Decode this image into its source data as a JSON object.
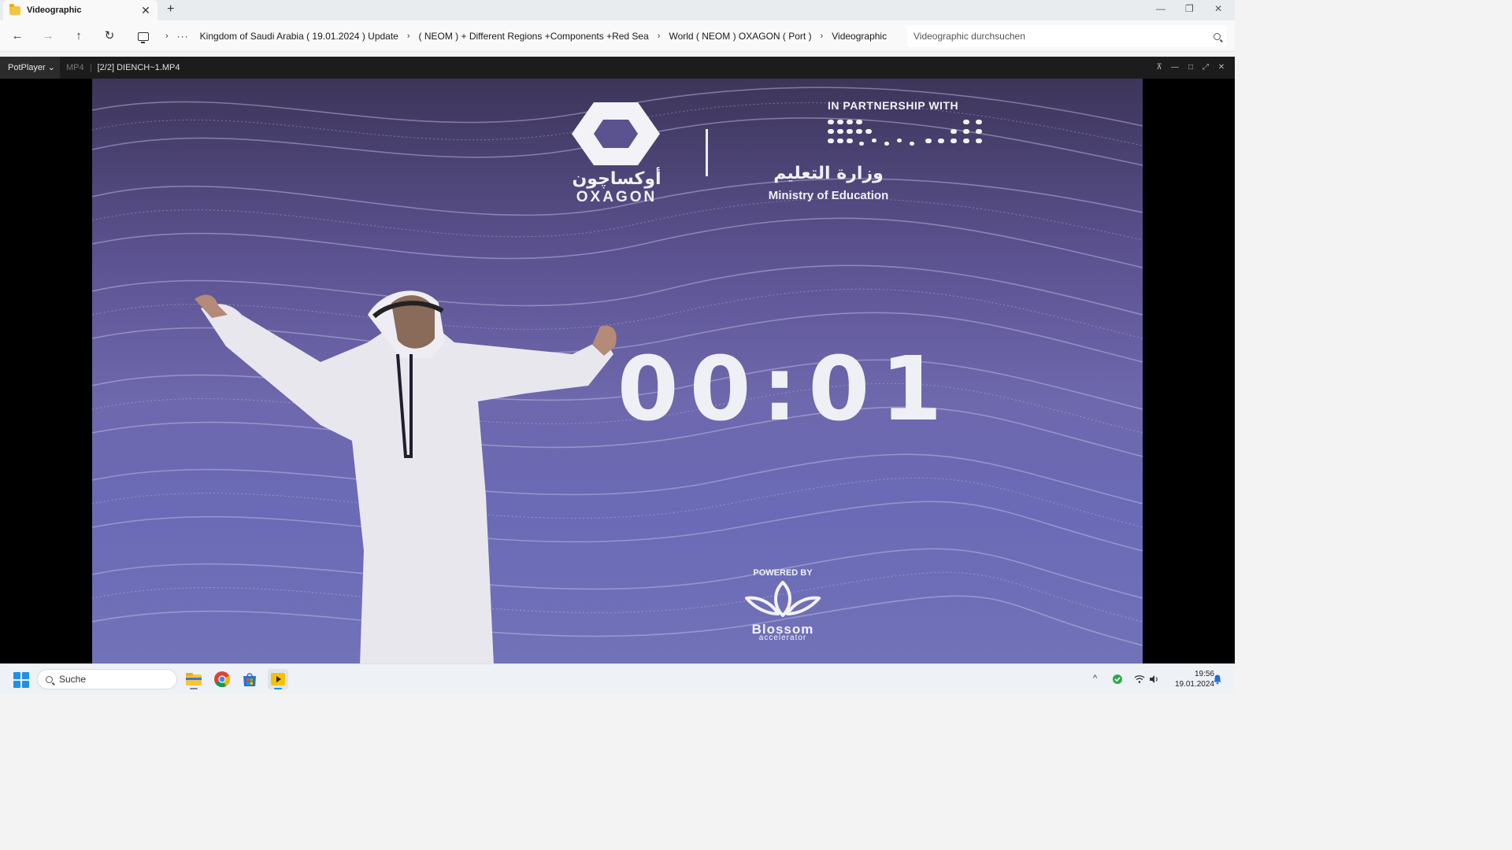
{
  "explorer": {
    "tab_title": "Videographic",
    "tab_close": "✕",
    "new_tab": "+",
    "window_controls": {
      "minimize": "—",
      "restore": "❐",
      "close": "✕"
    },
    "nav": {
      "back": "←",
      "forward": "→",
      "up": "↑",
      "refresh": "↻"
    },
    "breadcrumb": {
      "more": "···",
      "items": [
        "Kingdom of Saudi Arabia ( 19.01.2024 ) Update",
        "( NEOM ) + Different Regions +Components +Red Sea",
        "World ( NEOM ) OXAGON ( Port )",
        "Videographic"
      ]
    },
    "search_placeholder": "Videographic durchsuchen"
  },
  "player": {
    "brand": "PotPlayer",
    "brand_arrow": "⌄",
    "format": "MP4",
    "file": "[2/2] DIENCH~1.MP4",
    "controls": {
      "pin": "⊼",
      "minimize": "—",
      "maximize": "□",
      "fullscreen": "⤢",
      "close": "✕"
    }
  },
  "video": {
    "oxagon_arabic": "أوكساچون",
    "oxagon": "OXAGON",
    "partnership": "IN PARTNERSHIP WITH",
    "moe_arabic": "وزارة التعليم",
    "moe": "Ministry of Education",
    "countdown": "00:01",
    "powered_by": "POWERED BY",
    "blossom": "Blossom",
    "accelerator": "accelerator"
  },
  "taskbar": {
    "search_label": "Suche",
    "apps": [
      "file-explorer",
      "chrome",
      "microsoft-store",
      "potplayer"
    ],
    "tray_chevron": "^",
    "time": "19:56",
    "date": "19.01.2024"
  },
  "colors": {
    "video_bg": "#5b5290",
    "accent": "#1f8fe8"
  }
}
